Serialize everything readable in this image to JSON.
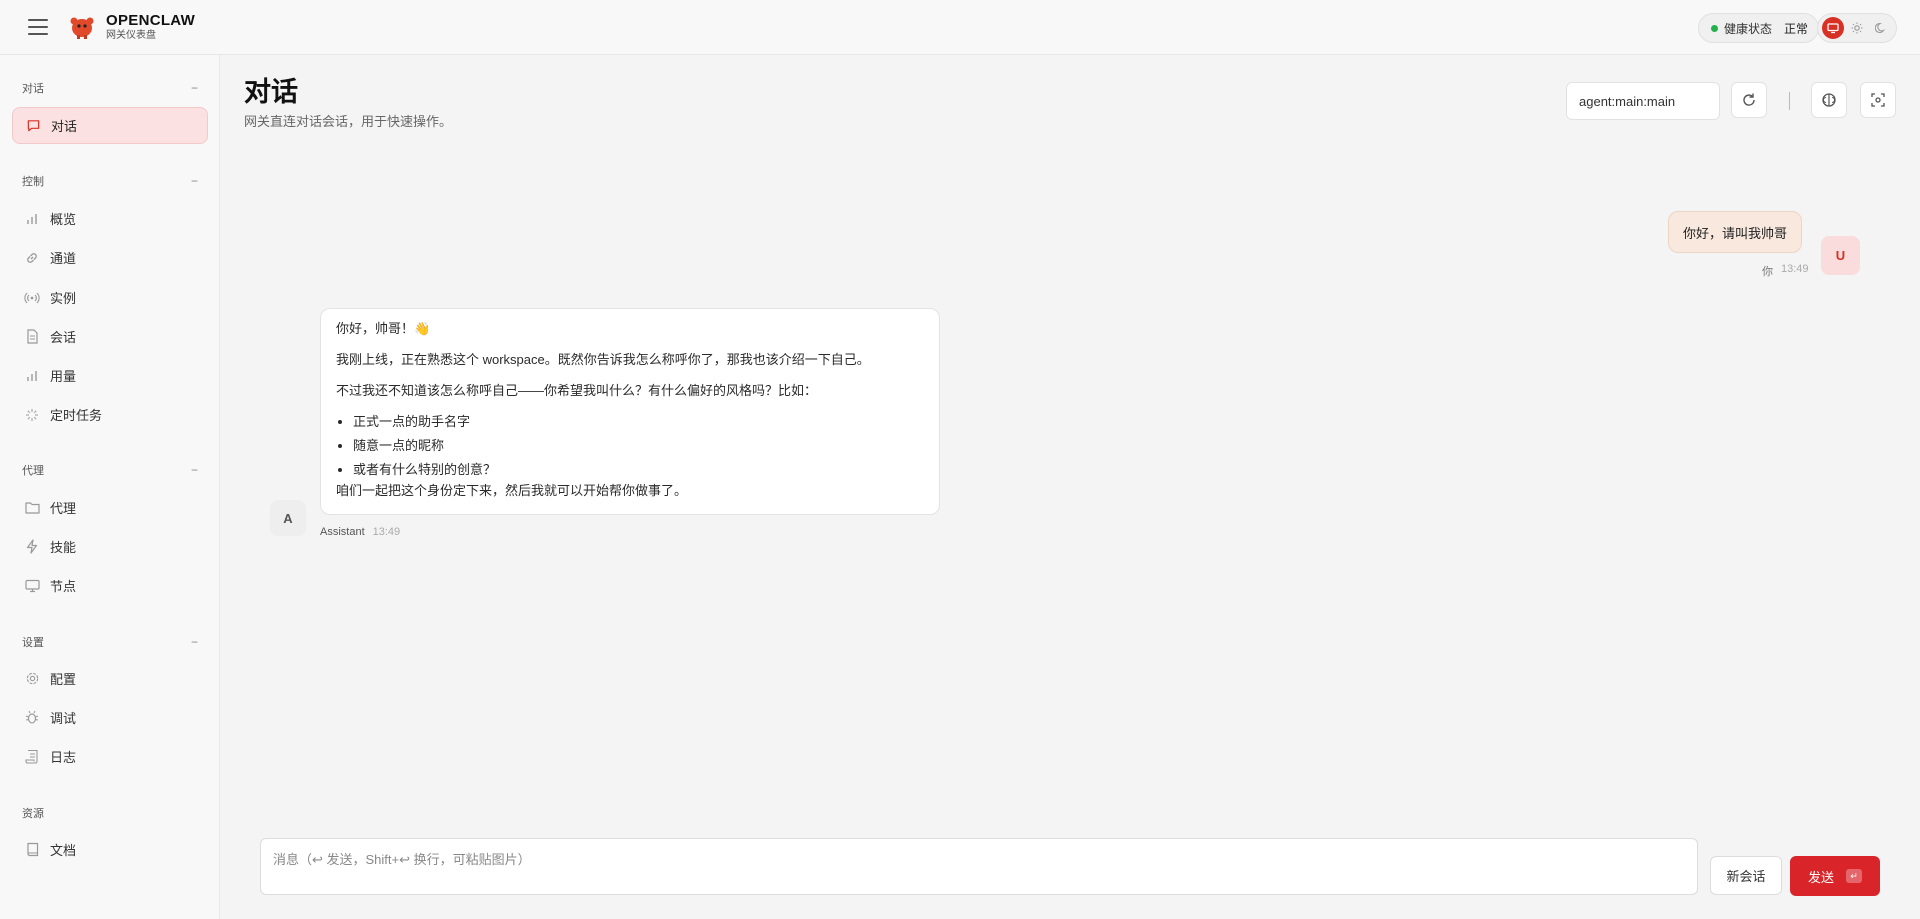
{
  "brand": {
    "name": "OPENCLAW",
    "subtitle": "网关仪表盘"
  },
  "health": {
    "label": "健康状态",
    "value": "正常",
    "status_color": "#22b14c"
  },
  "theme": {
    "options": [
      "monitor-icon",
      "sun-icon",
      "moon-icon"
    ],
    "active": "monitor-icon",
    "accent": "#d93025"
  },
  "sidebar": {
    "groups": [
      {
        "title": "对话",
        "collapse": "−",
        "items": [
          {
            "label": "对话",
            "icon": "chat-icon",
            "active": true
          }
        ]
      },
      {
        "title": "控制",
        "collapse": "−",
        "items": [
          {
            "label": "概览",
            "icon": "bar-chart-icon"
          },
          {
            "label": "通道",
            "icon": "link-icon"
          },
          {
            "label": "实例",
            "icon": "broadcast-icon"
          },
          {
            "label": "会话",
            "icon": "file-icon"
          },
          {
            "label": "用量",
            "icon": "bar-chart-icon"
          },
          {
            "label": "定时任务",
            "icon": "loader-icon"
          }
        ]
      },
      {
        "title": "代理",
        "collapse": "−",
        "items": [
          {
            "label": "代理",
            "icon": "folder-icon"
          },
          {
            "label": "技能",
            "icon": "bolt-icon"
          },
          {
            "label": "节点",
            "icon": "monitor-icon"
          }
        ]
      },
      {
        "title": "设置",
        "collapse": "−",
        "items": [
          {
            "label": "配置",
            "icon": "gear-icon"
          },
          {
            "label": "调试",
            "icon": "bug-icon"
          },
          {
            "label": "日志",
            "icon": "scroll-icon"
          }
        ]
      },
      {
        "title": "资源",
        "collapse": "",
        "items": [
          {
            "label": "文档",
            "icon": "book-icon"
          }
        ]
      }
    ]
  },
  "main": {
    "title": "对话",
    "subtitle": "网关直连对话会话，用于快速操作。",
    "session": "agent:main:main",
    "toolbar_icons": [
      "refresh-icon",
      "brain-icon",
      "focus-icon"
    ]
  },
  "chat": {
    "user": {
      "avatar": "U",
      "text": "你好，请叫我帅哥",
      "sender": "你",
      "time": "13:49"
    },
    "assistant": {
      "avatar": "A",
      "greeting": "你好，帅哥！👋",
      "p1": "我刚上线，正在熟悉这个 workspace。既然你告诉我怎么称呼你了，那我也该介绍一下自己。",
      "p2": "不过我还不知道该怎么称呼自己——你希望我叫什么？有什么偏好的风格吗？比如：",
      "list": [
        "正式一点的助手名字",
        "随意一点的昵称",
        "或者有什么特别的创意？"
      ],
      "closing": "咱们一起把这个身份定下来，然后我就可以开始帮你做事了。",
      "sender": "Assistant",
      "time": "13:49"
    }
  },
  "composer": {
    "placeholder": "消息（↩ 发送，Shift+↩ 换行，可粘贴图片）",
    "new_session": "新会话",
    "send": "发送",
    "send_kbd": "↵"
  }
}
